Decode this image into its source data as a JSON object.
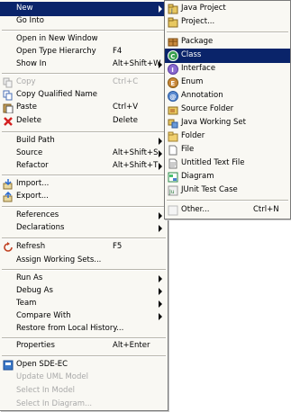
{
  "main_menu": {
    "new_label": "New",
    "go_into": "Go Into",
    "open_new_window": "Open in New Window",
    "open_type_hierarchy": "Open Type Hierarchy",
    "open_type_hierarchy_sc": "F4",
    "show_in": "Show In",
    "show_in_sc": "Alt+Shift+W",
    "copy": "Copy",
    "copy_sc": "Ctrl+C",
    "copy_qualified": "Copy Qualified Name",
    "paste": "Paste",
    "paste_sc": "Ctrl+V",
    "delete": "Delete",
    "delete_sc": "Delete",
    "build_path": "Build Path",
    "source": "Source",
    "source_sc": "Alt+Shift+S",
    "refactor": "Refactor",
    "refactor_sc": "Alt+Shift+T",
    "import": "Import...",
    "export": "Export...",
    "references": "References",
    "declarations": "Declarations",
    "refresh": "Refresh",
    "refresh_sc": "F5",
    "assign_working_sets": "Assign Working Sets...",
    "run_as": "Run As",
    "debug_as": "Debug As",
    "team": "Team",
    "compare_with": "Compare With",
    "restore_history": "Restore from Local History...",
    "properties": "Properties",
    "properties_sc": "Alt+Enter",
    "open_sde": "Open SDE-EC",
    "update_uml": "Update UML Model",
    "select_model": "Select In Model",
    "select_diagram": "Select In Diagram..."
  },
  "sub_menu": {
    "java_project": "Java Project",
    "project": "Project...",
    "package": "Package",
    "class": "Class",
    "interface": "Interface",
    "enum": "Enum",
    "annotation": "Annotation",
    "source_folder": "Source Folder",
    "java_working_set": "Java Working Set",
    "folder": "Folder",
    "file": "File",
    "untitled_text": "Untitled Text File",
    "diagram": "Diagram",
    "junit": "JUnit Test Case",
    "other": "Other...",
    "other_sc": "Ctrl+N"
  },
  "colors": {
    "selection": "#0a246a",
    "menu_bg": "#f9f8f3",
    "disabled": "#a9a9a9"
  }
}
